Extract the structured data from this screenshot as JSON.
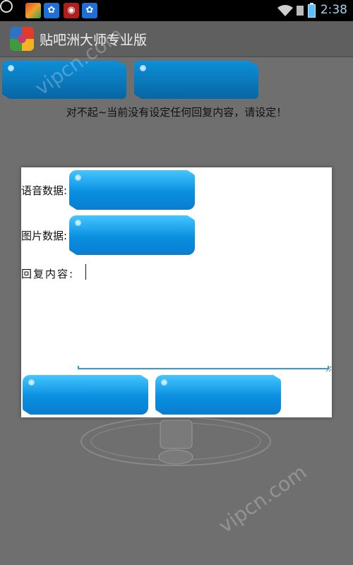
{
  "status_bar": {
    "time": "2:38"
  },
  "app": {
    "title": "贴吧洲大师专业版"
  },
  "background": {
    "button_left_label": "",
    "button_right_label": "",
    "message": "对不起~当前没有设定任何回复内容，请设定！"
  },
  "dialog": {
    "voice_label": "语音数据:",
    "voice_button": "",
    "image_label": "图片数据:",
    "image_button": "",
    "reply_label": "回复内容:",
    "reply_value": "",
    "ok_button": "",
    "cancel_button": ""
  },
  "watermark": {
    "text": "vipcn.com"
  }
}
